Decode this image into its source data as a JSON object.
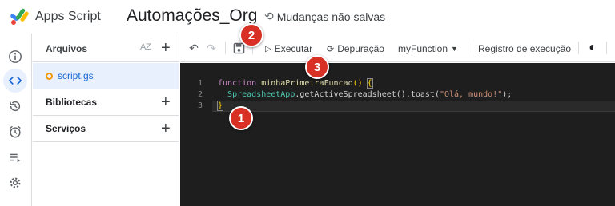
{
  "header": {
    "app_name": "Apps Script",
    "project_name": "Automações_Org",
    "save_status": "Mudanças não salvas"
  },
  "rail": {
    "items": [
      "info-icon",
      "code-icon",
      "history-icon",
      "alarm-icon",
      "executions-icon",
      "gear-icon"
    ],
    "active": "code-icon"
  },
  "files_panel": {
    "title": "Arquivos",
    "sort_label": "AZ",
    "files": [
      {
        "name": "script.gs"
      }
    ],
    "sections": [
      {
        "label": "Bibliotecas"
      },
      {
        "label": "Serviços"
      }
    ]
  },
  "toolbar": {
    "run_label": "Executar",
    "debug_label": "Depuração",
    "function_select": "myFunction",
    "exec_log_label": "Registro de execução"
  },
  "editor": {
    "line_numbers": [
      "1",
      "2",
      "3"
    ],
    "line1": {
      "keyword": "function",
      "name": "minhaPrimeiraFuncao",
      "parens": "()",
      "brace": "{"
    },
    "line2": {
      "obj": "SpreadsheetApp",
      "call": ".getActiveSpreadsheet().toast(",
      "string": "\"Olá, mundo!\"",
      "end": ");"
    },
    "line3": {
      "brace": "}"
    }
  },
  "annotations": [
    "1",
    "2",
    "3"
  ],
  "colors": {
    "accent": "#1967d2",
    "badge": "#d93025",
    "editor_bg": "#1e1e1e"
  }
}
